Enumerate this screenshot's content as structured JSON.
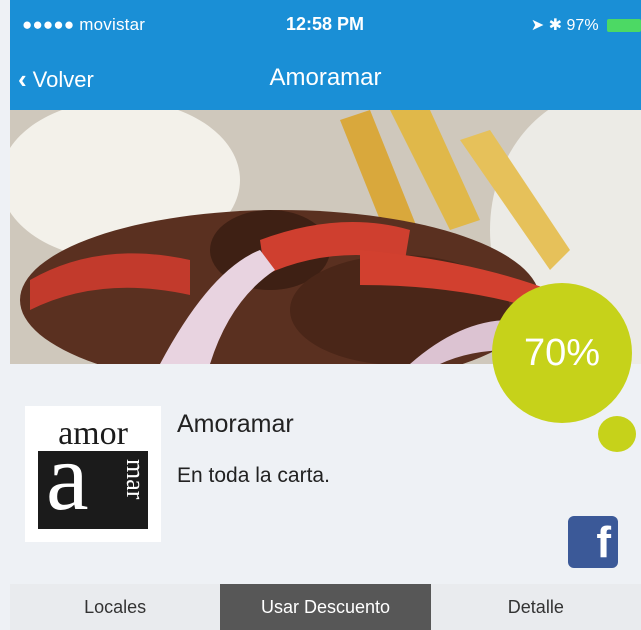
{
  "status_bar": {
    "carrier": "●●●●● movistar",
    "time": "12:58 PM",
    "battery": "97%"
  },
  "nav": {
    "back_label": "Volver",
    "title": "Amoramar"
  },
  "offer": {
    "discount": "70%",
    "shop_name": "Amoramar",
    "description": "En toda la carta."
  },
  "logo": {
    "text_top": "amor",
    "text_big": "a",
    "text_side": "mar"
  },
  "social": {
    "facebook_glyph": "f"
  },
  "tabs": [
    {
      "label": "Locales"
    },
    {
      "label": "Usar Descuento"
    },
    {
      "label": "Detalle"
    }
  ],
  "colors": {
    "topbar": "#1a8fd6",
    "accent": "#c6d21a",
    "active_tab": "#575757",
    "facebook": "#3b5998"
  }
}
